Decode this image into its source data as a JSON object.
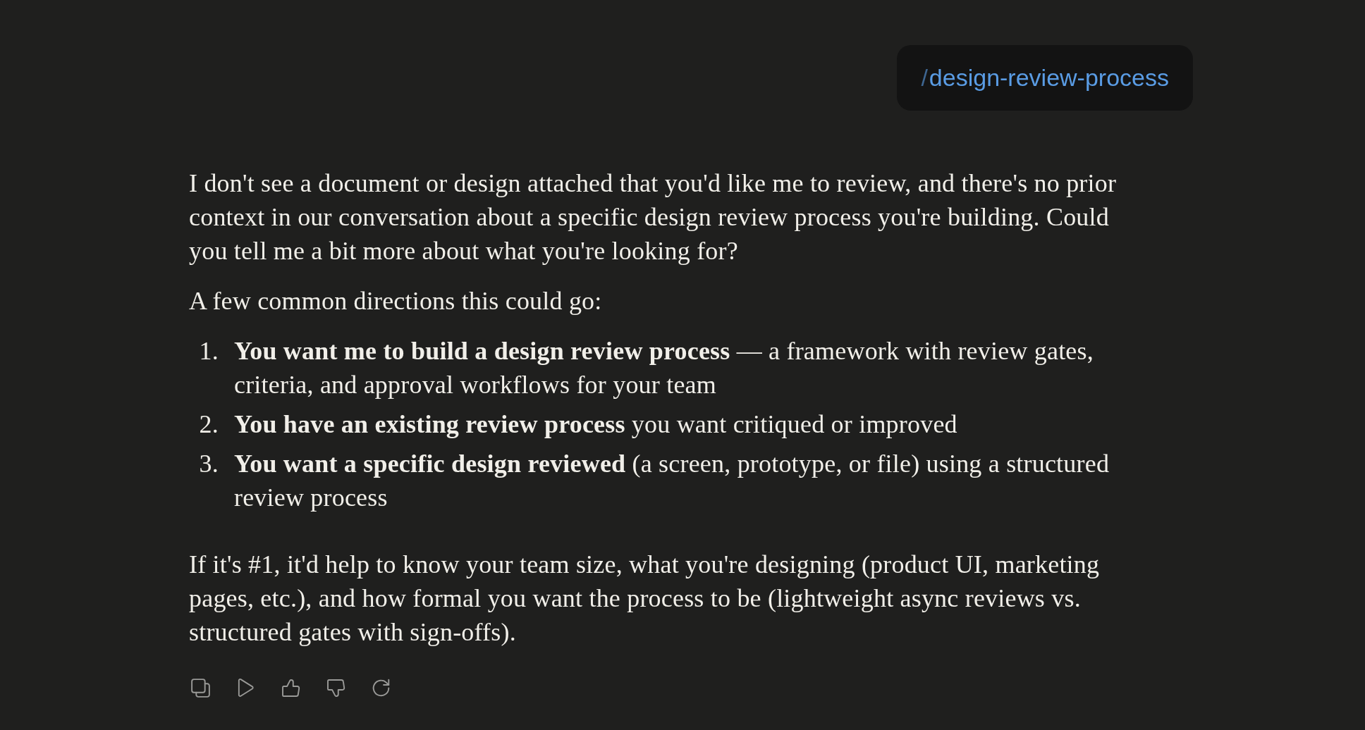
{
  "user_message": {
    "prefix": "/",
    "command": "design-review-process"
  },
  "response": {
    "blocks": [
      {
        "kind": "paragraph",
        "text": "I don't see a document or design attached that you'd like me to review, and there's no prior context in our conversation about a specific design review process you're building. Could you tell me a bit more about what you're looking for?"
      },
      {
        "kind": "paragraph",
        "text": "A few common directions this could go:"
      },
      {
        "kind": "list",
        "items": [
          {
            "number": "1.",
            "text": "**You want me to build a design review process** — a framework with review gates, criteria, and approval workflows for your team"
          },
          {
            "number": "2.",
            "text": "**You have an existing review process** you want critiqued or improved"
          },
          {
            "number": "3.",
            "text": "**You want a specific design reviewed** (a screen, prototype, or file) using a structured review process"
          }
        ]
      },
      {
        "kind": "paragraph",
        "text": "If it's #1, it'd help to know your team size, what you're designing (product UI, marketing pages, etc.), and how formal you want the process to be (lightweight async reviews vs. structured gates with sign-offs)."
      }
    ]
  },
  "actions": [
    {
      "kind": "copy"
    },
    {
      "kind": "play"
    },
    {
      "kind": "thumbs_up"
    },
    {
      "kind": "thumbs_down"
    },
    {
      "kind": "retry"
    }
  ]
}
